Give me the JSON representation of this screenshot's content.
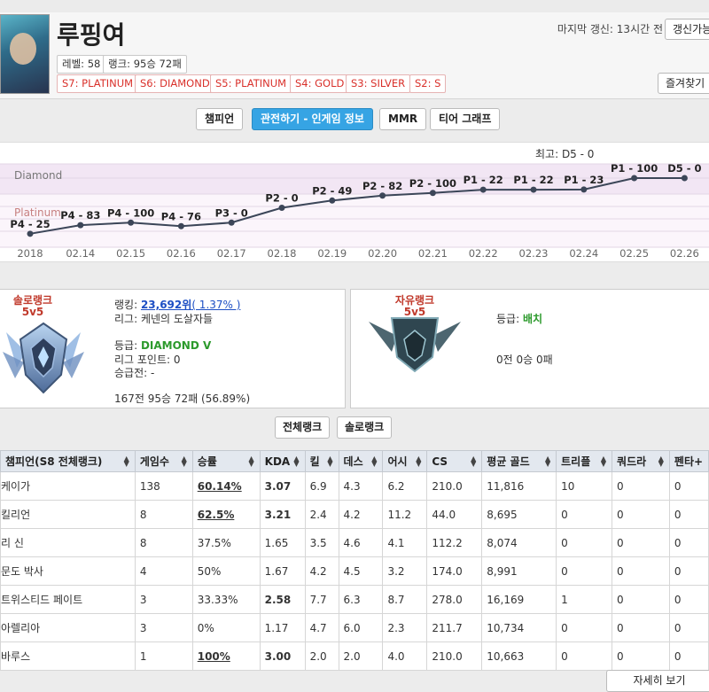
{
  "profile": {
    "name": "루핑여",
    "level": "레벨: 58",
    "rank_record": "랭크: 95승 72패",
    "seasons": [
      "S7: PLATINUM",
      "S6: DIAMOND",
      "S5: PLATINUM",
      "S4: GOLD",
      "S3: SILVER",
      "S2: S"
    ],
    "last_update": "마지막 갱신: 13시간 전",
    "update_button": "갱신가능",
    "favorite_button": "즐겨찾기"
  },
  "tabs": [
    "챔피언",
    "관전하기 - 인게임 정보",
    "MMR",
    "티어 그래프"
  ],
  "chart_data": {
    "type": "line",
    "title": "최고: D5 - 0",
    "x": [
      "2018",
      "02.14",
      "02.15",
      "02.16",
      "02.17",
      "02.18",
      "02.19",
      "02.20",
      "02.21",
      "02.22",
      "02.23",
      "02.24",
      "02.25",
      "02.26"
    ],
    "bands": [
      "Diamond",
      "Platinum"
    ],
    "series": [
      {
        "labels": [
          "P4 - 25",
          "P4 - 83",
          "P4 - 100",
          "P4 - 76",
          "P3 - 0",
          "P2 - 0",
          "P2 - 49",
          "P2 - 82",
          "P2 - 100",
          "P1 - 22",
          "P1 - 22",
          "P1 - 23",
          "P1 - 100",
          "D5 - 0"
        ],
        "values": [
          25,
          83,
          100,
          76,
          100,
          200,
          249,
          282,
          300,
          322,
          322,
          323,
          400,
          400
        ]
      }
    ],
    "grid": true
  },
  "solo_rank": {
    "title_line1": "솔로랭크",
    "title_line2": "5v5",
    "ranking_label": "랭킹: ",
    "ranking_value": "23,692위",
    "ranking_pct": "( 1.37% )",
    "league": "리그: 케넨의 도살자들",
    "tier_label": "등급: ",
    "tier_value": "DIAMOND V",
    "league_points": "리그 포인트: 0",
    "promo": "승급전: -",
    "record": "167전 95승 72패 (56.89%)",
    "emblem": "diamond-emblem-icon"
  },
  "flex_rank": {
    "title_line1": "자유랭크",
    "title_line2": "5v5",
    "tier_label": "등급: ",
    "tier_value": "배치",
    "record": "0전 0승 0패",
    "emblem": "unranked-emblem-icon"
  },
  "filters": [
    "전체랭크",
    "솔로랭크"
  ],
  "table": {
    "headers": [
      "챔피언(S8 전체랭크)",
      "게임수",
      "승률",
      "KDA",
      "킬",
      "데스",
      "어시",
      "CS",
      "평균 골드",
      "트리플",
      "쿼드라",
      "펜타+"
    ],
    "rows": [
      [
        "케이가",
        "138",
        "60.14%",
        "3.07",
        "6.9",
        "4.3",
        "6.2",
        "210.0",
        "11,816",
        "10",
        "0",
        "0"
      ],
      [
        "킬리언",
        "8",
        "62.5%",
        "3.21",
        "2.4",
        "4.2",
        "11.2",
        "44.0",
        "8,695",
        "0",
        "0",
        "0"
      ],
      [
        "리 신",
        "8",
        "37.5%",
        "1.65",
        "3.5",
        "4.6",
        "4.1",
        "112.2",
        "8,074",
        "0",
        "0",
        "0"
      ],
      [
        "문도 박사",
        "4",
        "50%",
        "1.67",
        "4.2",
        "4.5",
        "3.2",
        "174.0",
        "8,991",
        "0",
        "0",
        "0"
      ],
      [
        "트위스티드 페이트",
        "3",
        "33.33%",
        "2.58",
        "7.7",
        "6.3",
        "8.7",
        "278.0",
        "16,169",
        "1",
        "0",
        "0"
      ],
      [
        "아렐리아",
        "3",
        "0%",
        "1.17",
        "4.7",
        "6.0",
        "2.3",
        "211.7",
        "10,734",
        "0",
        "0",
        "0"
      ],
      [
        "바루스",
        "1",
        "100%",
        "3.00",
        "2.0",
        "2.0",
        "4.0",
        "210.0",
        "10,663",
        "0",
        "0",
        "0"
      ]
    ]
  },
  "more_button": "자세히 보기"
}
